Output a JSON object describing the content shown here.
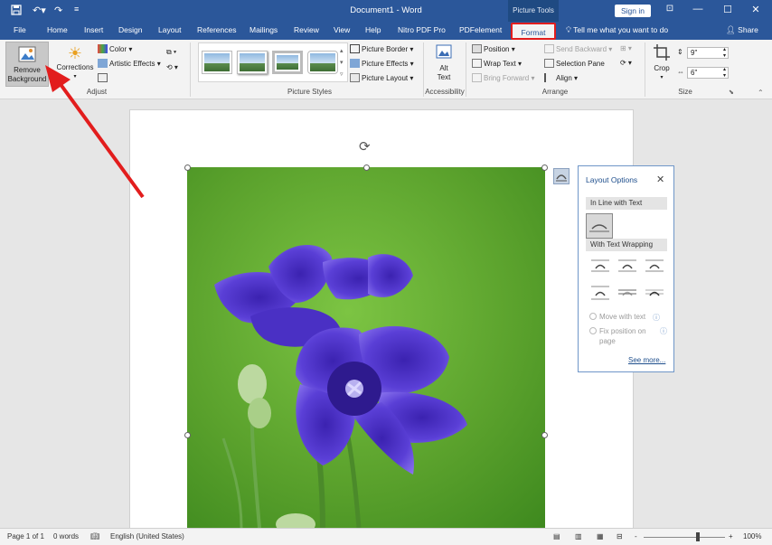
{
  "titlebar": {
    "doc_title": "Document1  -  Word",
    "context_tab_group": "Picture Tools",
    "sign_in": "Sign in",
    "save_icon": "save-icon",
    "undo_icon": "undo-icon",
    "redo_icon": "redo-icon",
    "customize_icon": "customize-qat-icon",
    "ribbon_display_icon": "ribbon-display-options-icon",
    "minimize_icon": "minimize-icon",
    "maximize_icon": "maximize-icon",
    "close_icon": "close-icon"
  },
  "tabs": {
    "items": [
      "File",
      "Home",
      "Insert",
      "Design",
      "Layout",
      "References",
      "Mailings",
      "Review",
      "View",
      "Help",
      "Nitro PDF Pro",
      "PDFelement"
    ],
    "active": "Format",
    "tell_me": "Tell me what you want to do",
    "share": "Share"
  },
  "ribbon": {
    "adjust": {
      "label": "Adjust",
      "remove_background": [
        "Remove",
        "Background"
      ],
      "corrections": "Corrections",
      "color": "Color",
      "artistic_effects": "Artistic Effects"
    },
    "picture_styles": {
      "label": "Picture Styles",
      "picture_border": "Picture Border",
      "picture_effects": "Picture Effects",
      "picture_layout": "Picture Layout"
    },
    "accessibility": {
      "label": "Accessibility",
      "alt_text": [
        "Alt",
        "Text"
      ]
    },
    "arrange": {
      "label": "Arrange",
      "position": "Position",
      "wrap_text": "Wrap Text",
      "bring_forward": "Bring Forward",
      "send_backward": "Send Backward",
      "selection_pane": "Selection Pane",
      "align": "Align"
    },
    "size": {
      "label": "Size",
      "crop": "Crop",
      "height": "9\"",
      "width": "6\""
    }
  },
  "layout_options": {
    "title": "Layout Options",
    "in_line": "In Line with Text",
    "with_wrapping": "With Text Wrapping",
    "move_with_text": "Move with text",
    "fix_position": [
      "Fix position on",
      "page"
    ],
    "see_more": "See more..."
  },
  "statusbar": {
    "page": "Page 1 of 1",
    "words": "0 words",
    "language": "English (United States)",
    "zoom": "100%",
    "zoom_minus": "-",
    "zoom_plus": "+"
  },
  "colors": {
    "brand_blue": "#2b579a",
    "highlight_red": "#e21d1d",
    "flower_purple": "#5a3fd6",
    "background_green": "#5aa12c"
  }
}
